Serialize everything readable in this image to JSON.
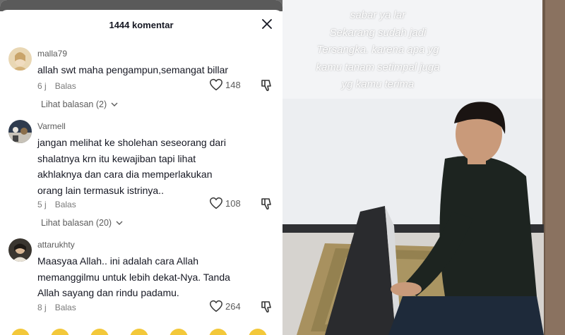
{
  "header": {
    "title": "1444 komentar"
  },
  "comments": [
    {
      "username": "malla79",
      "lines": [
        "allah swt maha pengampun,semangat billar"
      ],
      "time": "6 j",
      "reply_label": "Balas",
      "likes": "148",
      "view_replies": "Lihat balasan (2)"
    },
    {
      "username": "Varmell",
      "lines": [
        "jangan melihat ke sholehan seseorang dari",
        "shalatnya krn itu kewajiban tapi lihat",
        "akhlaknya dan cara dia memperlakukan",
        "orang lain termasuk istrinya.."
      ],
      "time": "5 j",
      "reply_label": "Balas",
      "likes": "108",
      "view_replies": "Lihat balasan (20)"
    },
    {
      "username": "attarukhty",
      "lines": [
        "Maasyaa Allah.. ini adalah cara Allah",
        "memanggilmu untuk lebih dekat-Nya. Tanda",
        "Allah sayang dan rindu padamu."
      ],
      "time": "8 j",
      "reply_label": "Balas",
      "likes": "264"
    }
  ],
  "video": {
    "caption": [
      "sabar ya lar",
      "Sekarang sudah jadi",
      "Tersangka. karena apa yg",
      "kamu tanam setimpal juga",
      "yg kamu terima"
    ]
  },
  "icons": {
    "close": "close-icon",
    "like": "heart-outline-icon",
    "dislike": "thumbs-down-icon",
    "expand": "chevron-down-icon"
  },
  "colors": {
    "text_primary": "#161823",
    "text_secondary": "#7a7a7a",
    "panel_bg": "#ffffff"
  }
}
